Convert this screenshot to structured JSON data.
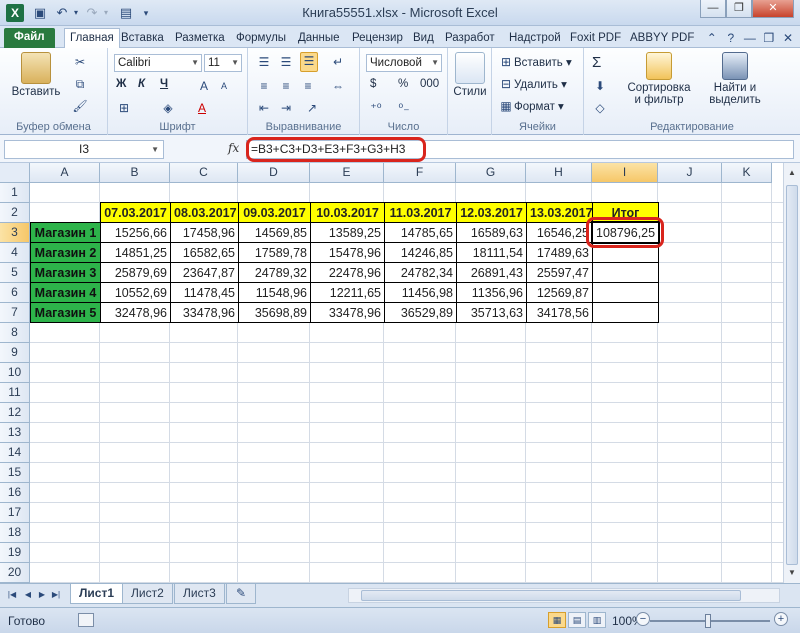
{
  "window": {
    "title": "Книга55551.xlsx - Microsoft Excel",
    "app_icon": "X"
  },
  "tabs": {
    "file": "Файл",
    "items": [
      "Главная",
      "Вставка",
      "Разметка",
      "Формулы",
      "Данные",
      "Рецензир",
      "Вид",
      "Разработ",
      "Надстрой",
      "Foxit PDF",
      "ABBYY PDF"
    ]
  },
  "ribbon": {
    "clipboard": {
      "paste_label": "Вставить",
      "group_label": "Буфер обмена"
    },
    "font": {
      "font_name": "Calibri",
      "font_size": "11",
      "bold": "Ж",
      "italic": "К",
      "underline": "Ч",
      "group_label": "Шрифт"
    },
    "alignment": {
      "group_label": "Выравнивание"
    },
    "number": {
      "format": "Числовой",
      "group_label": "Число",
      "currency": "$",
      "percent": "%",
      "thousands": "000"
    },
    "styles": {
      "label": "Стили"
    },
    "cells": {
      "insert": "Вставить",
      "delete": "Удалить",
      "format": "Формат",
      "group_label": "Ячейки"
    },
    "editing": {
      "sort_filter": "Сортировка",
      "sort_filter2": "и фильтр",
      "find_select": "Найти и",
      "find_select2": "выделить",
      "group_label": "Редактирование",
      "sigma": "Σ"
    }
  },
  "formula_bar": {
    "name_box": "I3",
    "fx": "fx",
    "formula": "=B3+C3+D3+E3+F3+G3+H3"
  },
  "grid": {
    "columns": [
      "A",
      "B",
      "C",
      "D",
      "E",
      "F",
      "G",
      "H",
      "I",
      "J",
      "K"
    ],
    "rows": [
      "1",
      "2",
      "3",
      "4",
      "5",
      "6",
      "7",
      "8",
      "9",
      "10",
      "11",
      "12",
      "13",
      "14",
      "15",
      "16",
      "17",
      "18",
      "19",
      "20"
    ],
    "dates": [
      "07.03.2017",
      "08.03.2017",
      "09.03.2017",
      "10.03.2017",
      "11.03.2017",
      "12.03.2017",
      "13.03.2017"
    ],
    "total_header": "Итог",
    "stores": [
      "Магазин 1",
      "Магазин 2",
      "Магазин 3",
      "Магазин 4",
      "Магазин 5"
    ],
    "values": [
      [
        "15256,66",
        "17458,96",
        "14569,85",
        "13589,25",
        "14785,65",
        "16589,63",
        "16546,25"
      ],
      [
        "14851,25",
        "16582,65",
        "17589,78",
        "15478,96",
        "14246,85",
        "18111,54",
        "17489,63"
      ],
      [
        "25879,69",
        "23647,87",
        "24789,32",
        "22478,96",
        "24782,34",
        "26891,43",
        "25597,47"
      ],
      [
        "10552,69",
        "11478,45",
        "11548,96",
        "12211,65",
        "11456,98",
        "11356,96",
        "12569,87"
      ],
      [
        "32478,96",
        "33478,96",
        "35698,89",
        "33478,96",
        "36529,89",
        "35713,63",
        "34178,56"
      ]
    ],
    "total_value": "108796,25"
  },
  "sheets": [
    "Лист1",
    "Лист2",
    "Лист3"
  ],
  "status": {
    "ready": "Готово",
    "zoom": "100%",
    "minus": "−",
    "plus": "+"
  }
}
